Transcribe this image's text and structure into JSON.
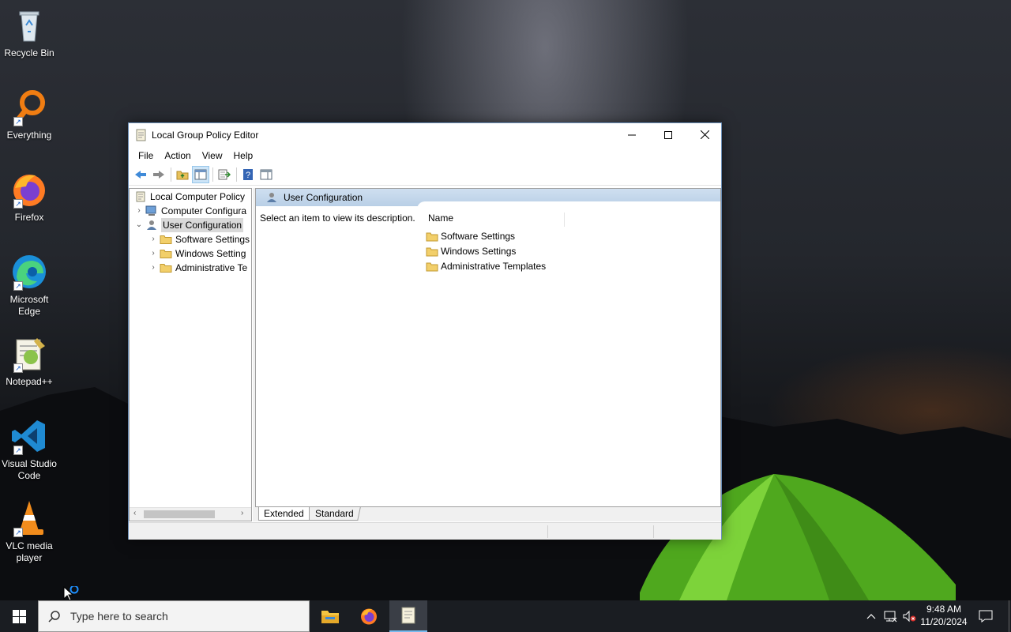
{
  "desktop": {
    "icons": [
      {
        "name": "recycle-bin",
        "label": "Recycle Bin"
      },
      {
        "name": "everything",
        "label": "Everything"
      },
      {
        "name": "firefox",
        "label": "Firefox"
      },
      {
        "name": "microsoft-edge",
        "label": "Microsoft Edge"
      },
      {
        "name": "notepad-plus-plus",
        "label": "Notepad++"
      },
      {
        "name": "vscode",
        "label": "Visual Studio Code"
      },
      {
        "name": "vlc",
        "label": "VLC media player"
      }
    ]
  },
  "window": {
    "title": "Local Group Policy Editor",
    "menu": [
      "File",
      "Action",
      "View",
      "Help"
    ],
    "tree": {
      "root": "Local Computer Policy",
      "computer_config": "Computer Configura",
      "user_config": "User Configuration",
      "children": [
        "Software Settings",
        "Windows Setting",
        "Administrative Te"
      ]
    },
    "right_pane": {
      "header_title": "User Configuration",
      "description": "Select an item to view its description.",
      "column_name": "Name",
      "items": [
        "Software Settings",
        "Windows Settings",
        "Administrative Templates"
      ]
    },
    "tabs": [
      "Extended",
      "Standard"
    ]
  },
  "taskbar": {
    "search_placeholder": "Type here to search",
    "time": "9:48 AM",
    "date": "11/20/2024"
  },
  "colors": {
    "selection_header": "#b9cfe6",
    "taskbar": "#1a1d22",
    "accent": "#76b9ed"
  }
}
